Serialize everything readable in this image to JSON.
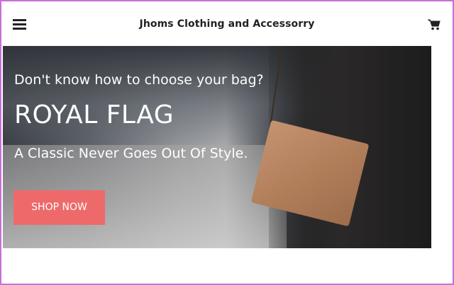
{
  "header": {
    "title": "Jhoms Clothing and Accessorry",
    "menu_icon": "hamburger-menu-icon",
    "cart_icon": "shopping-cart-icon"
  },
  "hero": {
    "kicker": "Don't know how to choose your bag?",
    "headline": "ROYAL FLAG",
    "tagline": "A Classic Never Goes Out Of Style.",
    "cta_label": "SHOP NOW",
    "cta_color": "#ee6a6a"
  }
}
